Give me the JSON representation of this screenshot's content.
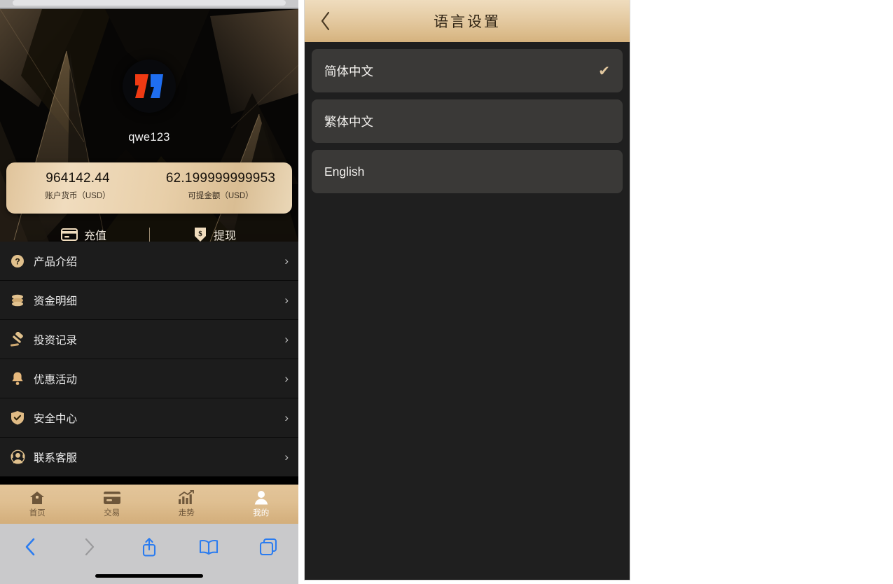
{
  "left_phone": {
    "profile": {
      "username": "qwe123",
      "logo_alt": "app-logo",
      "balance": [
        {
          "value": "964142.44",
          "label": "账户货币（USD）"
        },
        {
          "value": "62.199999999953",
          "label": "可提金额（USD）"
        }
      ],
      "actions": [
        {
          "icon": "card-icon",
          "label": "充值"
        },
        {
          "icon": "withdraw-dollar-icon",
          "label": "提现"
        }
      ]
    },
    "menu": [
      {
        "icon": "question-circle-icon",
        "label": "产品介绍",
        "chevron": "›"
      },
      {
        "icon": "coins-icon",
        "label": "资金明细",
        "chevron": "›"
      },
      {
        "icon": "gavel-icon",
        "label": "投资记录",
        "chevron": "›"
      },
      {
        "icon": "bell-icon",
        "label": "优惠活动",
        "chevron": "›"
      },
      {
        "icon": "shield-check-icon",
        "label": "安全中心",
        "chevron": "›"
      },
      {
        "icon": "headset-icon",
        "label": "联系客服",
        "chevron": "›"
      }
    ],
    "tabbar": [
      {
        "icon": "home-icon",
        "label": "首页",
        "active": false
      },
      {
        "icon": "card-icon",
        "label": "交易",
        "active": false
      },
      {
        "icon": "chart-up-icon",
        "label": "走势",
        "active": false
      },
      {
        "icon": "person-icon",
        "label": "我的",
        "active": true
      }
    ],
    "browser_toolbar": [
      {
        "icon": "back-chevron-icon",
        "enabled": true
      },
      {
        "icon": "forward-chevron-icon",
        "enabled": false
      },
      {
        "icon": "share-icon",
        "enabled": true
      },
      {
        "icon": "bookmarks-icon",
        "enabled": true
      },
      {
        "icon": "tabs-icon",
        "enabled": true
      }
    ]
  },
  "right_phone": {
    "header": {
      "title": "语言设置",
      "back_icon": "back-chevron-icon"
    },
    "languages": [
      {
        "label": "简体中文",
        "selected": true,
        "check": "✔"
      },
      {
        "label": "繁体中文",
        "selected": false,
        "check": ""
      },
      {
        "label": "English",
        "selected": false,
        "check": ""
      }
    ]
  },
  "colors": {
    "gold": "#dcbd8d",
    "gold_light": "#efdcbd",
    "dark_bg": "#1f1f1f",
    "card_bg": "#3a3937",
    "menu_bg": "#1c1c1c",
    "logo_red": "#f03a13",
    "logo_blue": "#1f6ef0",
    "safari_blue": "#2b7cf0"
  }
}
